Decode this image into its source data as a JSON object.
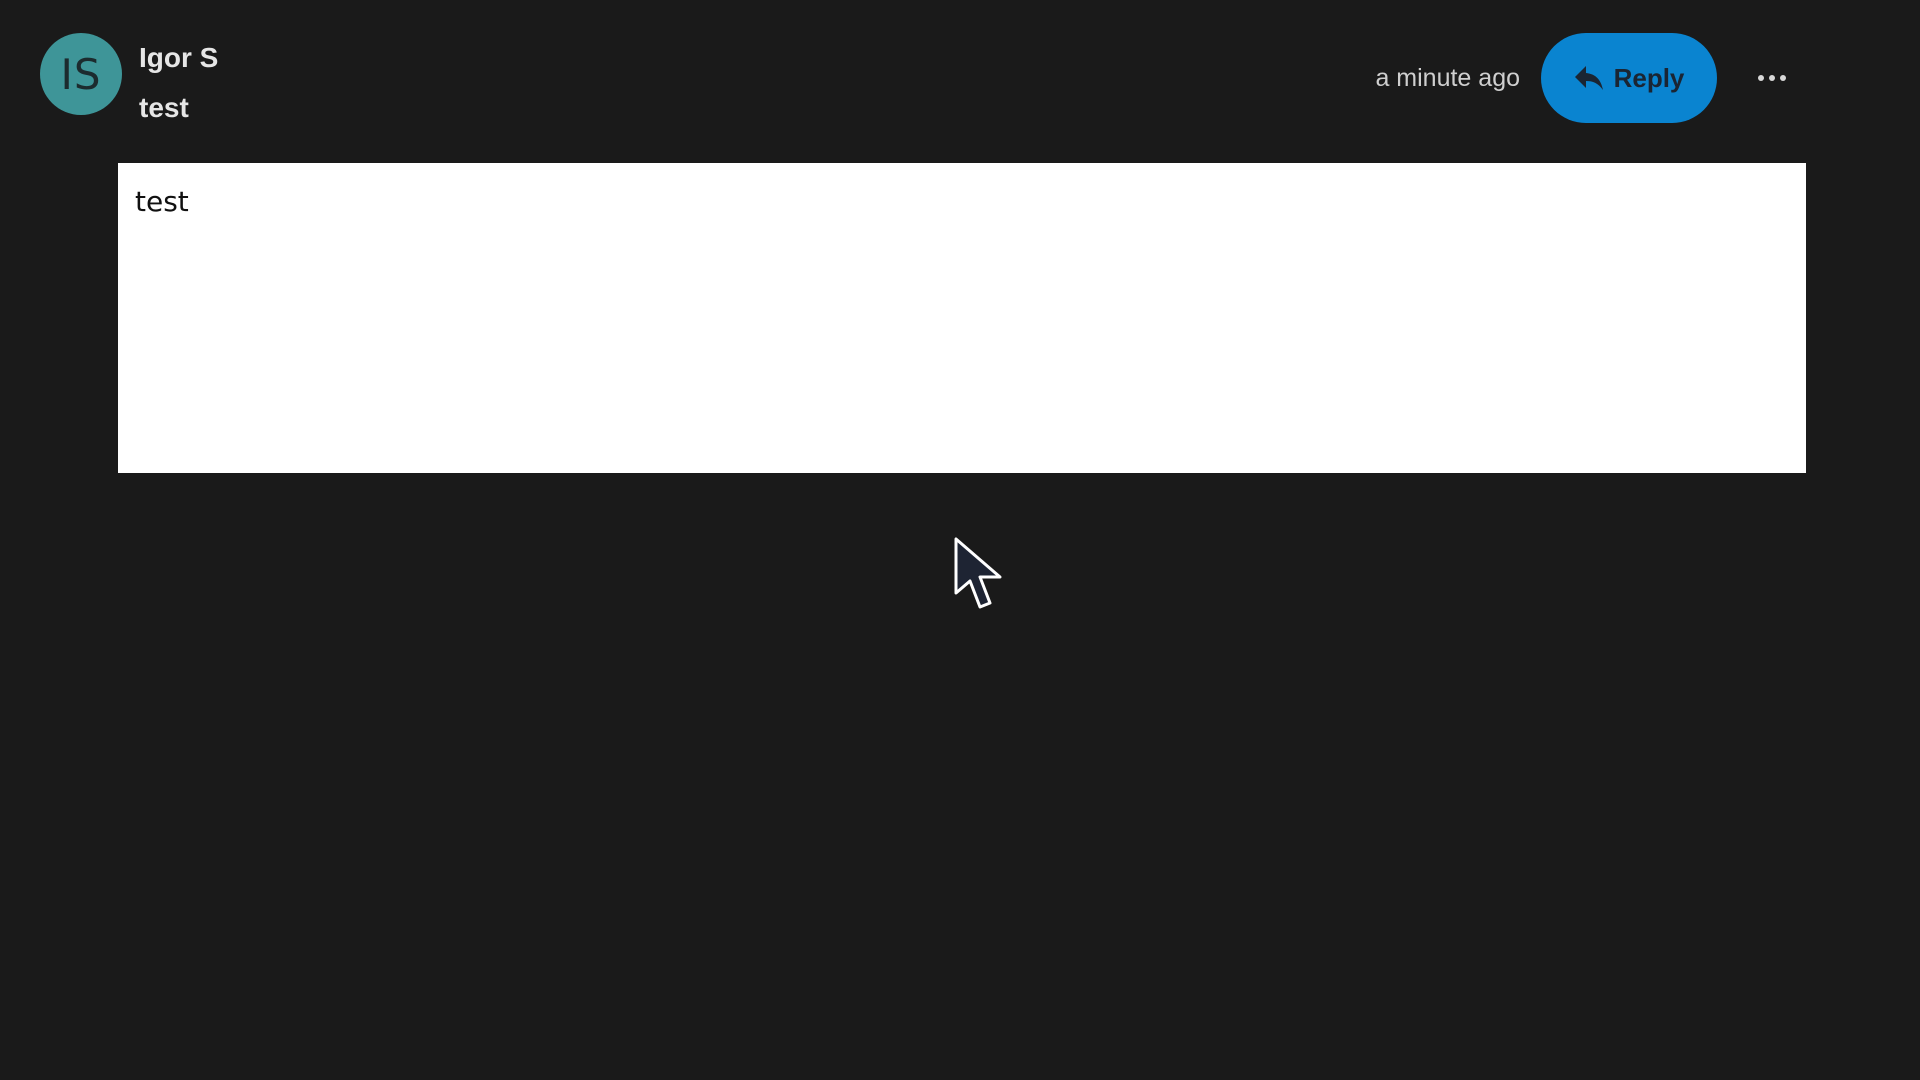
{
  "message": {
    "avatar_initials": "IS",
    "author": "Igor S",
    "subject": "test",
    "timestamp": "a minute ago",
    "body": "test"
  },
  "actions": {
    "reply_label": "Reply",
    "reply_icon": "reply-arrow-icon",
    "more_icon": "ellipsis-icon"
  },
  "colors": {
    "background": "#1a1a1a",
    "avatar": "#3e9598",
    "reply_button": "#0a84d0",
    "body_background": "#ffffff"
  }
}
